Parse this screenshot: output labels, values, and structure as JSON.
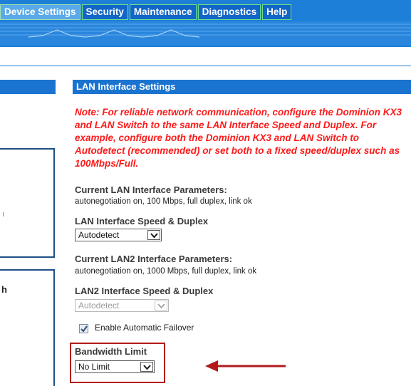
{
  "nav": {
    "tabs": [
      {
        "label": "Device Settings",
        "active": true
      },
      {
        "label": "Security",
        "active": false
      },
      {
        "label": "Maintenance",
        "active": false
      },
      {
        "label": "Diagnostics",
        "active": false
      },
      {
        "label": "Help",
        "active": false
      }
    ]
  },
  "left_column": {
    "partial_heading": "h"
  },
  "panel": {
    "title": "LAN Interface Settings",
    "note": "Note: For reliable network communication, configure the Dominion KX3 and LAN Switch to the same LAN Interface Speed and Duplex. For example, configure both the Dominion KX3 and LAN Switch to Autodetect (recommended) or set both to a fixed speed/duplex such as 100Mbps/Full.",
    "current_lan_label": "Current LAN Interface Parameters:",
    "current_lan_value": "autonegotiation on, 100 Mbps, full duplex, link ok",
    "lan_speed_label": "LAN Interface Speed & Duplex",
    "lan_speed_value": "Autodetect",
    "current_lan2_label": "Current LAN2 Interface Parameters:",
    "current_lan2_value": "autonegotiation on, 1000 Mbps, full duplex, link ok",
    "lan2_speed_label": "LAN2 Interface Speed & Duplex",
    "lan2_speed_value": "Autodetect",
    "failover_label": "Enable Automatic Failover",
    "failover_checked": true,
    "bandwidth_label": "Bandwidth Limit",
    "bandwidth_value": "No Limit"
  },
  "colors": {
    "banner_blue": "#1e7fd8",
    "header_blue": "#1a74cf",
    "note_red": "#ff1a1a",
    "highlight_red": "#b31b1b"
  }
}
